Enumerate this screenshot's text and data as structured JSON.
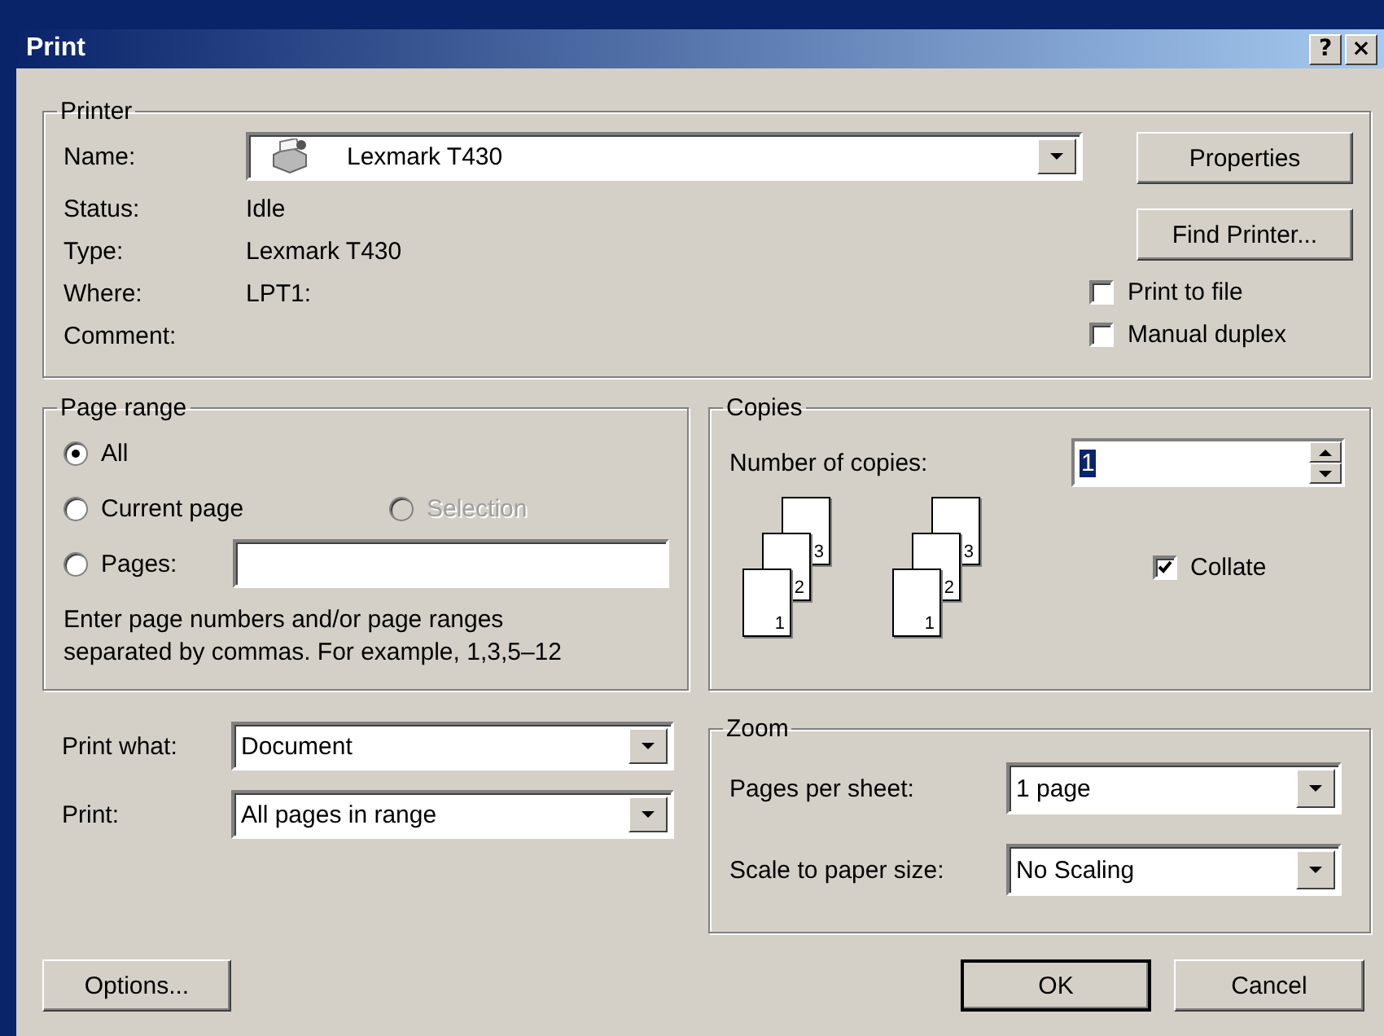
{
  "window": {
    "title": "Print",
    "help_button": "?",
    "close_button": "×"
  },
  "printer": {
    "legend": "Printer",
    "name_label": "Name:",
    "name_value": "Lexmark T430",
    "info": [
      {
        "label": "Status:",
        "value": "Idle"
      },
      {
        "label": "Type:",
        "value": "Lexmark T430"
      },
      {
        "label": "Where:",
        "value": "LPT1:"
      },
      {
        "label": "Comment:"
      }
    ],
    "buttons": [
      "Properties",
      "Find Printer..."
    ],
    "options": [
      {
        "label": "Print to file",
        "checked": false
      },
      {
        "label": "Manual duplex",
        "checked": false
      }
    ]
  },
  "page_range": {
    "legend": "Page range",
    "choices": [
      {
        "label": "All",
        "selected": true,
        "disabled": false
      },
      {
        "label": "Current page",
        "selected": false,
        "disabled": false
      },
      {
        "label": "Selection",
        "selected": false,
        "disabled": true
      },
      {
        "label": "Pages:",
        "selected": false,
        "disabled": false
      }
    ],
    "hint": "Enter page numbers and/or page ranges\nseparated by commas.  For example, 1,3,5–12"
  },
  "copies": {
    "legend": "Copies",
    "label": "Number of copies:",
    "value": "1",
    "stacks": [
      [
        "1",
        "2",
        "3"
      ],
      [
        "1",
        "2",
        "3"
      ]
    ],
    "collate": {
      "label": "Collate",
      "checked": true
    }
  },
  "print_what": {
    "label": "Print what:",
    "value": "Document"
  },
  "print": {
    "label": "Print:",
    "value": "All pages in range"
  },
  "zoom": {
    "legend": "Zoom",
    "fields": [
      {
        "label": "Pages per sheet:",
        "value": "1 page"
      },
      {
        "label": "Scale to paper size:",
        "value": "No Scaling"
      }
    ]
  },
  "buttons": [
    {
      "label": "Options...",
      "default": false
    },
    {
      "label": "OK",
      "default": true
    },
    {
      "label": "Cancel",
      "default": false
    }
  ]
}
